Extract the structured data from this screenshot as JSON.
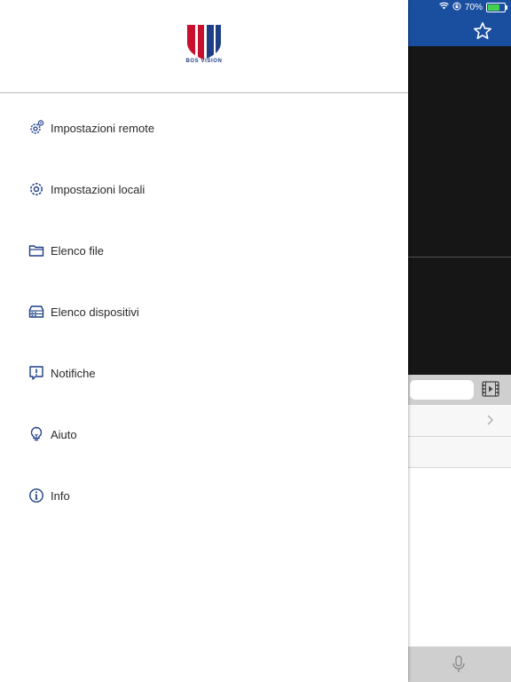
{
  "status_bar": {
    "battery": "70%",
    "battery_level": 0.7
  },
  "logo": {
    "text": "BOS VISION"
  },
  "menu": {
    "items": [
      {
        "label": "Impostazioni remote",
        "icon": "gear-remote-icon"
      },
      {
        "label": "Impostazioni locali",
        "icon": "gear-icon"
      },
      {
        "label": "Elenco file",
        "icon": "folder-icon"
      },
      {
        "label": "Elenco dispositivi",
        "icon": "device-icon"
      },
      {
        "label": "Notifiche",
        "icon": "alert-icon"
      },
      {
        "label": "Aiuto",
        "icon": "bulb-icon"
      },
      {
        "label": "Info",
        "icon": "info-icon"
      }
    ]
  },
  "colors": {
    "header": "#1a4fa0",
    "icon": "#1e3f86",
    "logo_red": "#c8102e",
    "logo_blue": "#1e3f86"
  }
}
